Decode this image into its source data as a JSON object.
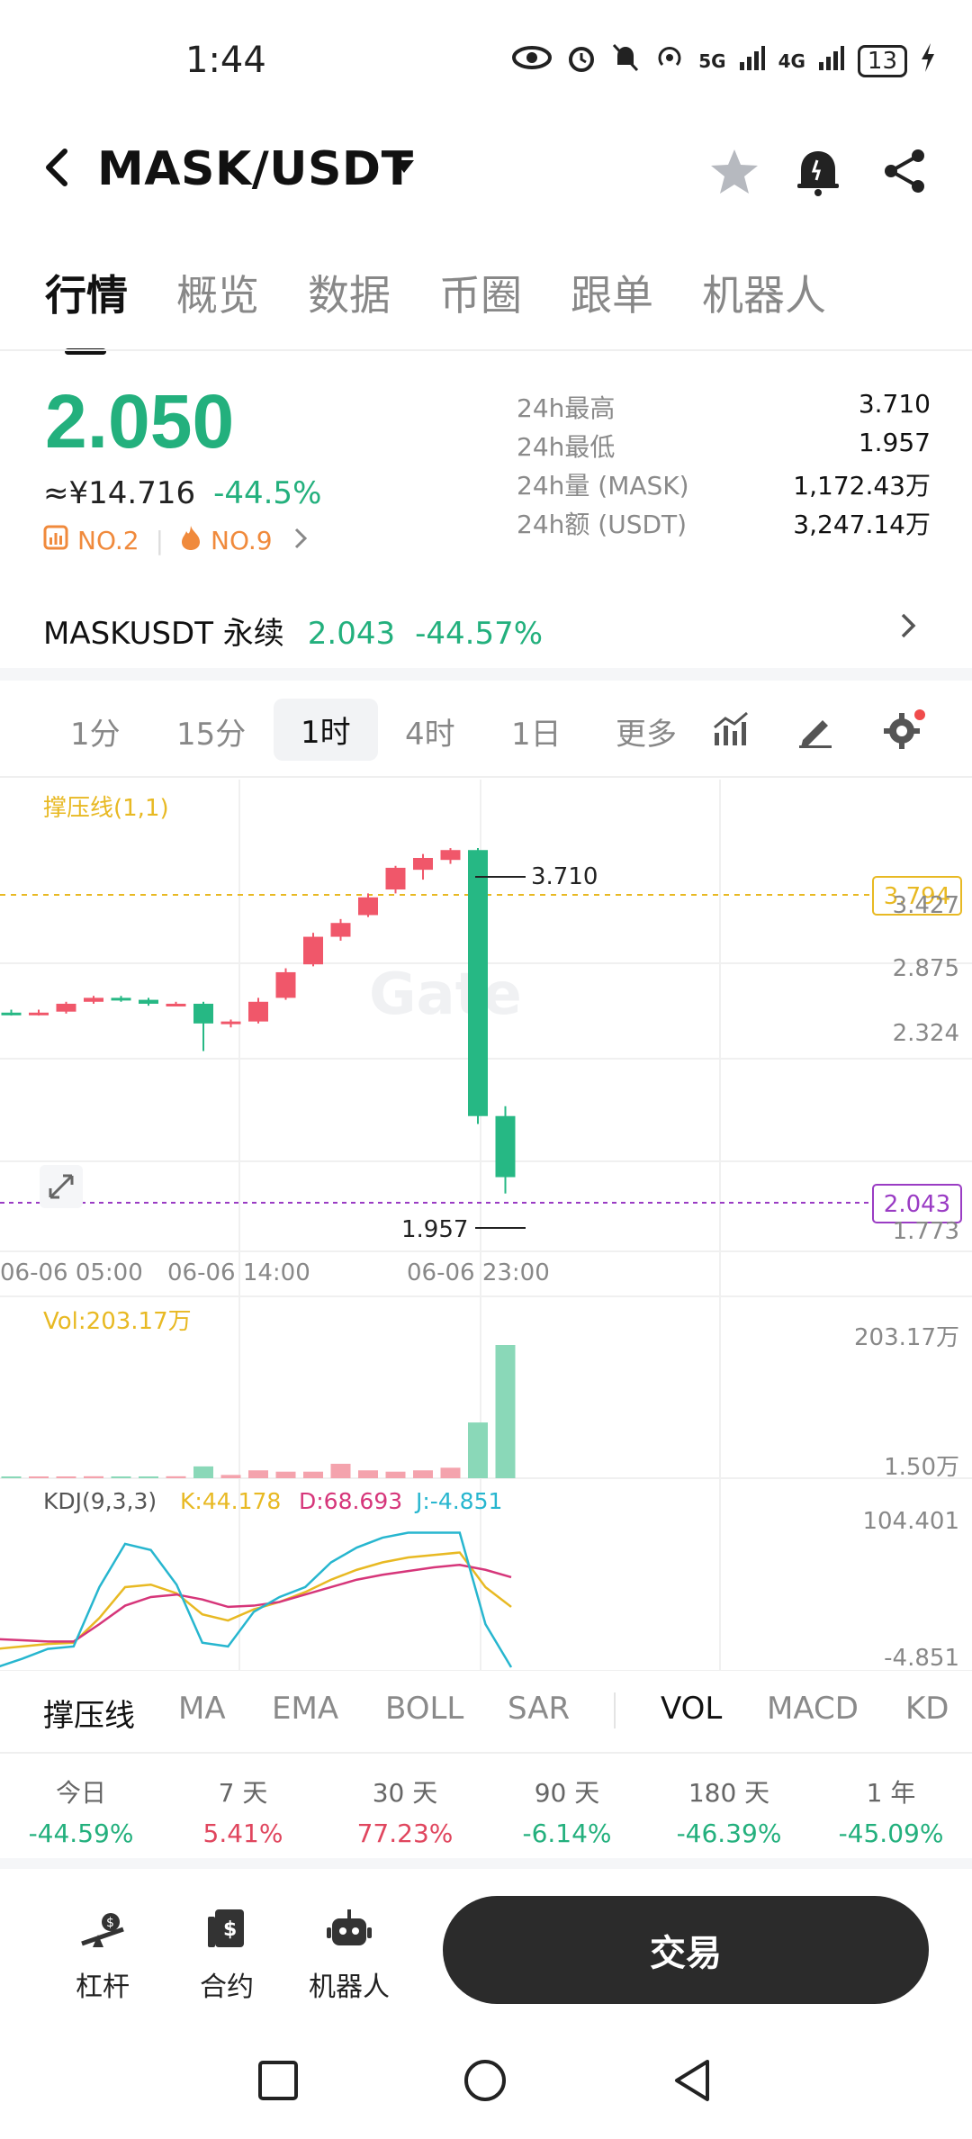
{
  "status": {
    "time": "1:44",
    "net1": "5G",
    "net2": "4G",
    "battery": "13"
  },
  "header": {
    "pair": "MASK/USDT"
  },
  "tabs": [
    "行情",
    "概览",
    "数据",
    "币圈",
    "跟单",
    "机器人"
  ],
  "price": {
    "last": "2.050",
    "cny": "≈¥14.716",
    "change": "-44.5%",
    "rank1": "NO.2",
    "rank2": "NO.9"
  },
  "stats": [
    {
      "k": "24h最高",
      "v": "3.710"
    },
    {
      "k": "24h最低",
      "v": "1.957"
    },
    {
      "k": "24h量 (MASK)",
      "v": "1,172.43万"
    },
    {
      "k": "24h额 (USDT)",
      "v": "3,247.14万"
    }
  ],
  "perp": {
    "name": "MASKUSDT 永续",
    "price": "2.043",
    "change": "-44.57%"
  },
  "intervals": [
    "1分",
    "15分",
    "1时",
    "4时",
    "1日",
    "更多"
  ],
  "chart": {
    "indicator_label": "撑压线(1,1)",
    "watermark": "Gate",
    "price_ticks": [
      "3.427",
      "2.875",
      "2.324",
      "1.773"
    ],
    "resistance": "3.794",
    "current": "2.043",
    "high_label": "3.710",
    "low_label": "1.957",
    "time_ticks": [
      "06-06 05:00",
      "06-06 14:00",
      "06-06 23:00"
    ],
    "vol_label": "Vol:203.17万",
    "vol_max": "203.17万",
    "vol_min": "1.50万",
    "kdj_label": "KDJ(9,3,3)",
    "kdj_k": "K:44.178",
    "kdj_d": "D:68.693",
    "kdj_j": "J:-4.851",
    "kdj_max": "104.401",
    "kdj_min": "-4.851"
  },
  "candles": [
    {
      "o": 2.87,
      "h": 2.89,
      "l": 2.86,
      "c": 2.875
    },
    {
      "o": 2.875,
      "h": 2.89,
      "l": 2.86,
      "c": 2.87
    },
    {
      "o": 2.87,
      "h": 2.89,
      "l": 2.86,
      "c": 2.875
    },
    {
      "o": 2.88,
      "h": 2.93,
      "l": 2.87,
      "c": 2.92
    },
    {
      "o": 2.93,
      "h": 2.96,
      "l": 2.92,
      "c": 2.95
    },
    {
      "o": 2.95,
      "h": 2.96,
      "l": 2.93,
      "c": 2.94
    },
    {
      "o": 2.94,
      "h": 2.95,
      "l": 2.91,
      "c": 2.92
    },
    {
      "o": 2.92,
      "h": 2.93,
      "l": 2.91,
      "c": 2.92
    },
    {
      "o": 2.92,
      "h": 2.93,
      "l": 2.68,
      "c": 2.82
    },
    {
      "o": 2.82,
      "h": 2.84,
      "l": 2.8,
      "c": 2.83
    },
    {
      "o": 2.83,
      "h": 2.95,
      "l": 2.82,
      "c": 2.93
    },
    {
      "o": 2.95,
      "h": 3.1,
      "l": 2.94,
      "c": 3.08
    },
    {
      "o": 3.12,
      "h": 3.28,
      "l": 3.11,
      "c": 3.26
    },
    {
      "o": 3.26,
      "h": 3.35,
      "l": 3.24,
      "c": 3.33
    },
    {
      "o": 3.37,
      "h": 3.48,
      "l": 3.36,
      "c": 3.46
    },
    {
      "o": 3.5,
      "h": 3.62,
      "l": 3.48,
      "c": 3.61
    },
    {
      "o": 3.6,
      "h": 3.68,
      "l": 3.55,
      "c": 3.66
    },
    {
      "o": 3.65,
      "h": 3.71,
      "l": 3.63,
      "c": 3.7
    },
    {
      "o": 3.7,
      "h": 3.71,
      "l": 2.31,
      "c": 2.35
    },
    {
      "o": 2.35,
      "h": 2.4,
      "l": 1.957,
      "c": 2.04
    }
  ],
  "volumes": [
    1.5,
    1.5,
    1.5,
    2,
    3,
    2,
    2,
    3,
    18,
    5,
    12,
    10,
    10,
    22,
    12,
    10,
    12,
    16,
    85,
    203.17
  ],
  "kdj": {
    "k": [
      10,
      12,
      14,
      15,
      35,
      60,
      62,
      55,
      38,
      33,
      42,
      48,
      56,
      66,
      74,
      80,
      84,
      86,
      88,
      60,
      44
    ],
    "d": [
      18,
      17,
      16,
      16,
      30,
      45,
      52,
      54,
      50,
      44,
      45,
      48,
      54,
      60,
      66,
      70,
      73,
      76,
      78,
      74,
      68
    ],
    "j": [
      -5,
      2,
      10,
      12,
      60,
      95,
      90,
      62,
      15,
      12,
      40,
      52,
      60,
      80,
      92,
      100,
      104,
      104,
      104,
      30,
      -4.851
    ]
  },
  "bottom_indicators": [
    "撑压线",
    "MA",
    "EMA",
    "BOLL",
    "SAR",
    "VOL",
    "MACD",
    "KD"
  ],
  "performance": [
    {
      "label": "今日",
      "value": "-44.59%",
      "color": "#23b07d"
    },
    {
      "label": "7 天",
      "value": "5.41%",
      "color": "#e0465e"
    },
    {
      "label": "30 天",
      "value": "77.23%",
      "color": "#e0465e"
    },
    {
      "label": "90 天",
      "value": "-6.14%",
      "color": "#23b07d"
    },
    {
      "label": "180 天",
      "value": "-46.39%",
      "color": "#23b07d"
    },
    {
      "label": "1 年",
      "value": "-45.09%",
      "color": "#23b07d"
    }
  ],
  "actions": {
    "leverage": "杠杆",
    "contract": "合约",
    "robot": "机器人",
    "trade": "交易"
  },
  "colors": {
    "up": "#f0576a",
    "down": "#26b884",
    "accent": "#e8b923"
  }
}
